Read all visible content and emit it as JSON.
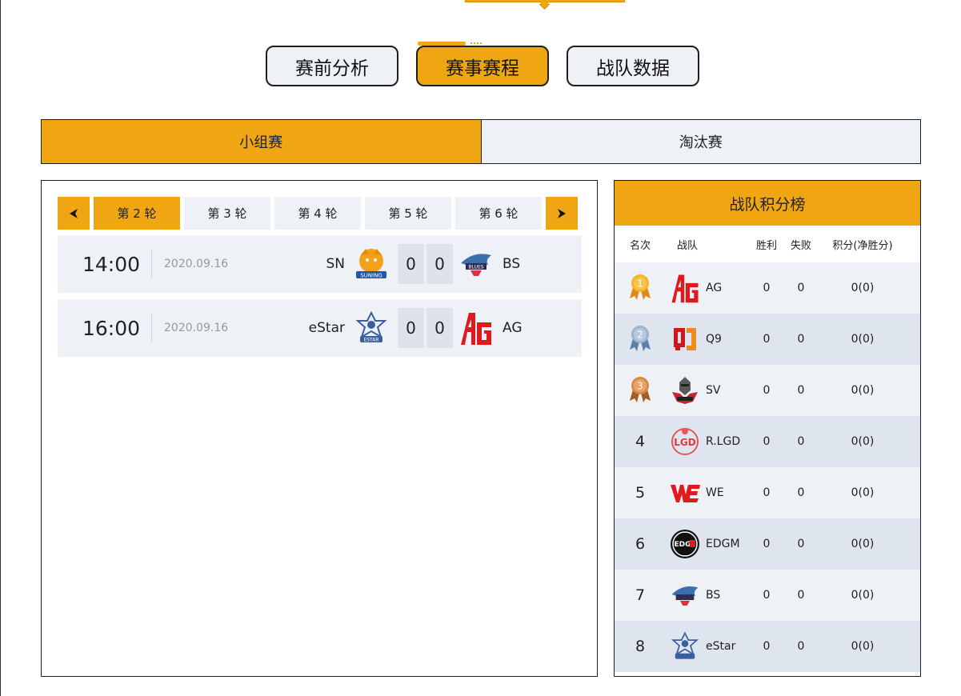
{
  "main_tabs": [
    {
      "label": "赛前分析",
      "active": false
    },
    {
      "label": "赛事赛程",
      "active": true
    },
    {
      "label": "战队数据",
      "active": false
    }
  ],
  "stage_tabs": [
    {
      "label": "小组赛",
      "active": true
    },
    {
      "label": "淘汰赛",
      "active": false
    }
  ],
  "round_nav": {
    "prev_icon": "arrow-left-icon",
    "next_icon": "arrow-right-icon",
    "rounds": [
      {
        "label": "第 2 轮",
        "active": true
      },
      {
        "label": "第 3 轮",
        "active": false
      },
      {
        "label": "第 4 轮",
        "active": false
      },
      {
        "label": "第 5 轮",
        "active": false
      },
      {
        "label": "第 6 轮",
        "active": false
      }
    ]
  },
  "matches": [
    {
      "time": "14:00",
      "date": "2020.09.16",
      "home": "SN",
      "home_score": "0",
      "away_score": "0",
      "away": "BS"
    },
    {
      "time": "16:00",
      "date": "2020.09.16",
      "home": "eStar",
      "home_score": "0",
      "away_score": "0",
      "away": "AG"
    }
  ],
  "standings": {
    "title": "战队积分榜",
    "headers": {
      "rank": "名次",
      "team": "战队",
      "win": "胜利",
      "lose": "失败",
      "points": "积分(净胜分)"
    },
    "rows": [
      {
        "rank": "1",
        "team": "AG",
        "win": "0",
        "lose": "0",
        "points": "0(0)"
      },
      {
        "rank": "2",
        "team": "Q9",
        "win": "0",
        "lose": "0",
        "points": "0(0)"
      },
      {
        "rank": "3",
        "team": "SV",
        "win": "0",
        "lose": "0",
        "points": "0(0)"
      },
      {
        "rank": "4",
        "team": "R.LGD",
        "win": "0",
        "lose": "0",
        "points": "0(0)"
      },
      {
        "rank": "5",
        "team": "WE",
        "win": "0",
        "lose": "0",
        "points": "0(0)"
      },
      {
        "rank": "6",
        "team": "EDGM",
        "win": "0",
        "lose": "0",
        "points": "0(0)"
      },
      {
        "rank": "7",
        "team": "BS",
        "win": "0",
        "lose": "0",
        "points": "0(0)"
      },
      {
        "rank": "8",
        "team": "eStar",
        "win": "0",
        "lose": "0",
        "points": "0(0)"
      }
    ]
  },
  "colors": {
    "accent": "#f0a612",
    "panel_light": "#eef1f6",
    "panel_dark": "#dfe5ee",
    "border": "#1f1f1f"
  }
}
